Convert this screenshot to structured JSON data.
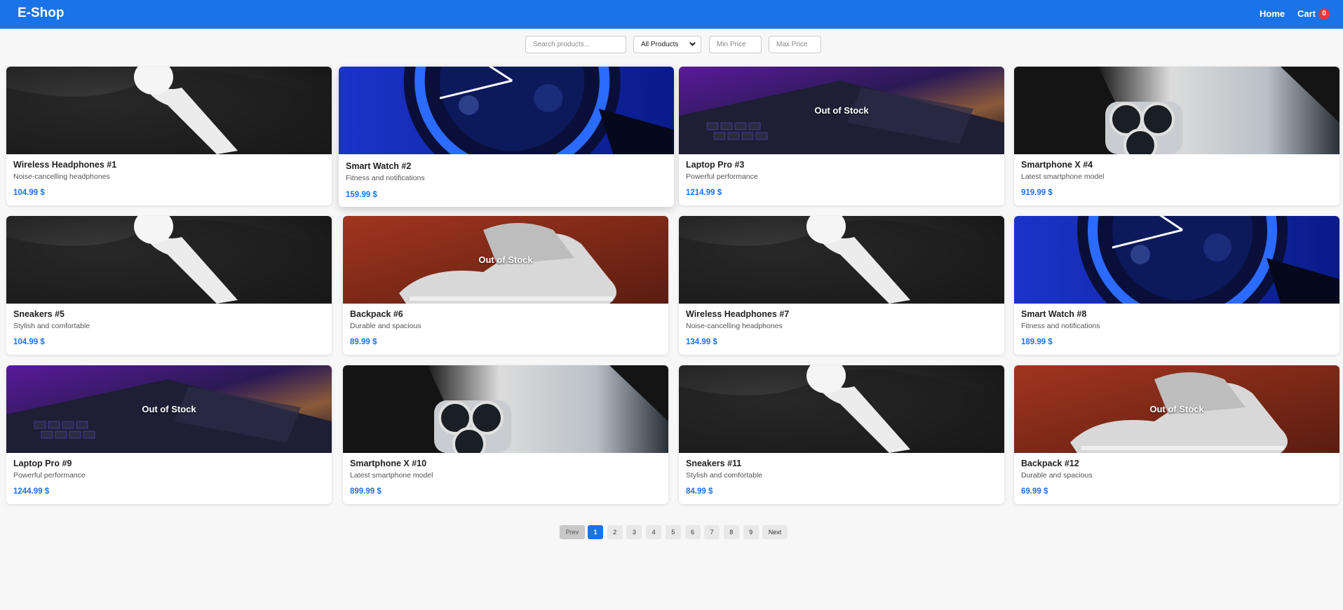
{
  "header": {
    "brand": "E-Shop",
    "home": "Home",
    "cart": "Cart",
    "cart_count": "0"
  },
  "filters": {
    "search_placeholder": "Search products...",
    "category_selected": "All Products",
    "min_placeholder": "Min Price",
    "max_placeholder": "Max Price"
  },
  "products": [
    {
      "name": "Wireless Headphones #1",
      "desc": "Noise-cancelling headphones",
      "price": "104.99 $",
      "image": "earbud",
      "oos": ""
    },
    {
      "name": "Smart Watch #2",
      "desc": "Fitness and notifications",
      "price": "159.99 $",
      "image": "watch",
      "oos": ""
    },
    {
      "name": "Laptop Pro #3",
      "desc": "Powerful performance",
      "price": "1214.99 $",
      "image": "laptop",
      "oos": "Out of Stock"
    },
    {
      "name": "Smartphone X #4",
      "desc": "Latest smartphone model",
      "price": "919.99 $",
      "image": "phone",
      "oos": ""
    },
    {
      "name": "Sneakers #5",
      "desc": "Stylish and comfortable",
      "price": "104.99 $",
      "image": "earbud",
      "oos": ""
    },
    {
      "name": "Backpack #6",
      "desc": "Durable and spacious",
      "price": "89.99 $",
      "image": "sneaker",
      "oos": "Out of Stock"
    },
    {
      "name": "Wireless Headphones #7",
      "desc": "Noise-cancelling headphones",
      "price": "134.99 $",
      "image": "earbud",
      "oos": ""
    },
    {
      "name": "Smart Watch #8",
      "desc": "Fitness and notifications",
      "price": "189.99 $",
      "image": "watch",
      "oos": ""
    },
    {
      "name": "Laptop Pro #9",
      "desc": "Powerful performance",
      "price": "1244.99 $",
      "image": "laptop",
      "oos": "Out of Stock"
    },
    {
      "name": "Smartphone X #10",
      "desc": "Latest smartphone model",
      "price": "899.99 $",
      "image": "phone",
      "oos": ""
    },
    {
      "name": "Sneakers #11",
      "desc": "Stylish and comfortable",
      "price": "84.99 $",
      "image": "earbud",
      "oos": ""
    },
    {
      "name": "Backpack #12",
      "desc": "Durable and spacious",
      "price": "69.99 $",
      "image": "sneaker",
      "oos": "Out of Stock"
    }
  ],
  "pagination": {
    "prev": "Prev",
    "next": "Next",
    "pages": [
      "1",
      "2",
      "3",
      "4",
      "5",
      "6",
      "7",
      "8",
      "9"
    ],
    "active": "1"
  }
}
